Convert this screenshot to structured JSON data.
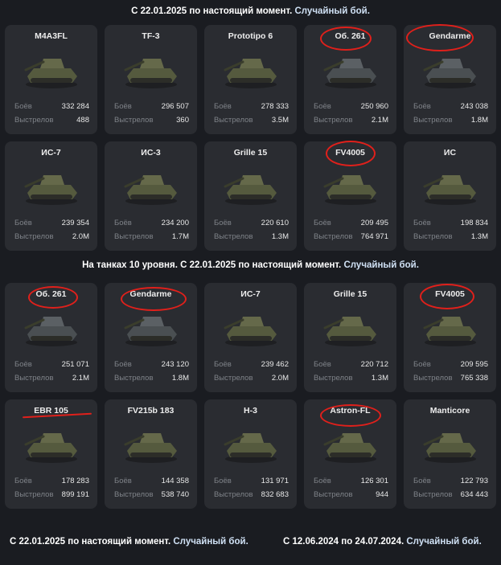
{
  "section1": {
    "title_prefix": "С 22.01.2025 по настоящий момент.",
    "title_suffix": "Случайный бой."
  },
  "section2": {
    "title_prefix": "На танках 10 уровня. С 22.01.2025 по настоящий момент.",
    "title_suffix": "Случайный бой."
  },
  "footer": {
    "left_prefix": "С 22.01.2025 по настоящий момент.",
    "left_suffix": "Случайный бой.",
    "right_prefix": "С 12.06.2024 по 24.07.2024.",
    "right_suffix": "Случайный бой."
  },
  "labels": {
    "battles": "Боёв",
    "shots": "Выстрелов"
  },
  "colors": {
    "background": "#1a1c21",
    "card": "#2a2c31",
    "marker": "#e0201b",
    "accent_text": "#cfe0f4"
  },
  "grid1": [
    {
      "name": "M4A3FL",
      "battles": "332 284",
      "shots": "488",
      "icon": "tank-icon"
    },
    {
      "name": "TF-3",
      "battles": "296 507",
      "shots": "360",
      "icon": "tank-icon"
    },
    {
      "name": "Prototipo 6",
      "battles": "278 333",
      "shots": "3.5M",
      "icon": "tank-icon"
    },
    {
      "name": "Об. 261",
      "battles": "250 960",
      "shots": "2.1M",
      "icon": "spg-icon"
    },
    {
      "name": "Gendarme",
      "battles": "243 038",
      "shots": "1.8M",
      "icon": "spg-icon"
    },
    {
      "name": "ИС-7",
      "battles": "239 354",
      "shots": "2.0M",
      "icon": "tank-icon"
    },
    {
      "name": "ИС-3",
      "battles": "234 200",
      "shots": "1.7M",
      "icon": "tank-icon"
    },
    {
      "name": "Grille 15",
      "battles": "220 610",
      "shots": "1.3M",
      "icon": "tank-icon"
    },
    {
      "name": "FV4005",
      "battles": "209 495",
      "shots": "764 971",
      "icon": "tank-icon"
    },
    {
      "name": "ИС",
      "battles": "198 834",
      "shots": "1.3M",
      "icon": "tank-icon"
    }
  ],
  "grid2": [
    {
      "name": "Об. 261",
      "battles": "251 071",
      "shots": "2.1M",
      "icon": "spg-icon"
    },
    {
      "name": "Gendarme",
      "battles": "243 120",
      "shots": "1.8M",
      "icon": "spg-icon"
    },
    {
      "name": "ИС-7",
      "battles": "239 462",
      "shots": "2.0M",
      "icon": "tank-icon"
    },
    {
      "name": "Grille 15",
      "battles": "220 712",
      "shots": "1.3M",
      "icon": "tank-icon"
    },
    {
      "name": "FV4005",
      "battles": "209 595",
      "shots": "765 338",
      "icon": "tank-icon"
    },
    {
      "name": "EBR 105",
      "battles": "178 283",
      "shots": "899 191",
      "icon": "tank-icon"
    },
    {
      "name": "FV215b 183",
      "battles": "144 358",
      "shots": "538 740",
      "icon": "tank-icon"
    },
    {
      "name": "Н-3",
      "battles": "131 971",
      "shots": "832 683",
      "icon": "tank-icon"
    },
    {
      "name": "Astron-FL",
      "battles": "126 301",
      "shots": "944",
      "icon": "tank-icon"
    },
    {
      "name": "Manticore",
      "battles": "122 793",
      "shots": "634 443",
      "icon": "tank-icon"
    }
  ]
}
